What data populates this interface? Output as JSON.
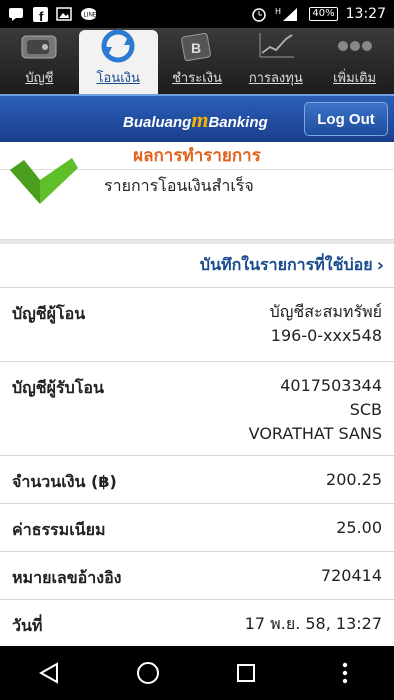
{
  "status_bar": {
    "battery": "40%",
    "time": "13:27",
    "network": "H",
    "left_icons": [
      "sms-icon",
      "facebook-icon",
      "image-icon",
      "line-icon"
    ]
  },
  "tabs": [
    {
      "label": "บัญชี",
      "icon": "wallet-icon"
    },
    {
      "label": "โอนเงิน",
      "icon": "transfer-icon"
    },
    {
      "label": "ชำระเงิน",
      "icon": "bill-icon"
    },
    {
      "label": "การลงทุน",
      "icon": "chart-icon"
    },
    {
      "label": "เพิ่มเติม",
      "icon": "more-icon"
    }
  ],
  "header": {
    "brand_left": "Bualuang",
    "brand_m": "m",
    "brand_right": "Banking",
    "logout_label": "Log Out"
  },
  "result": {
    "title": "ผลการทำรายการ",
    "success_message": "รายการโอนเงินสำเร็จ",
    "favorite_link": "บันทึกในรายการที่ใช้บ่อย"
  },
  "details": {
    "from_label": "บัญชีผู้โอน",
    "from_type": "บัญชีสะสมทรัพย์",
    "from_number": "196-0-xxx548",
    "to_label": "บัญชีผู้รับโอน",
    "to_number": "4017503344",
    "to_bank": "SCB",
    "to_name": "VORATHAT SANS",
    "amount_label": "จำนวนเงิน (฿)",
    "amount": "200.25",
    "fee_label": "ค่าธรรมเนียม",
    "fee": "25.00",
    "ref_label": "หมายเลขอ้างอิง",
    "ref": "720414",
    "date_label": "วันที่",
    "date": "17 พ.ย. 58, 13:27"
  },
  "colors": {
    "brand_blue": "#1a4b8c",
    "accent_orange": "#e0641e",
    "check_green": "#5fbf2a"
  }
}
